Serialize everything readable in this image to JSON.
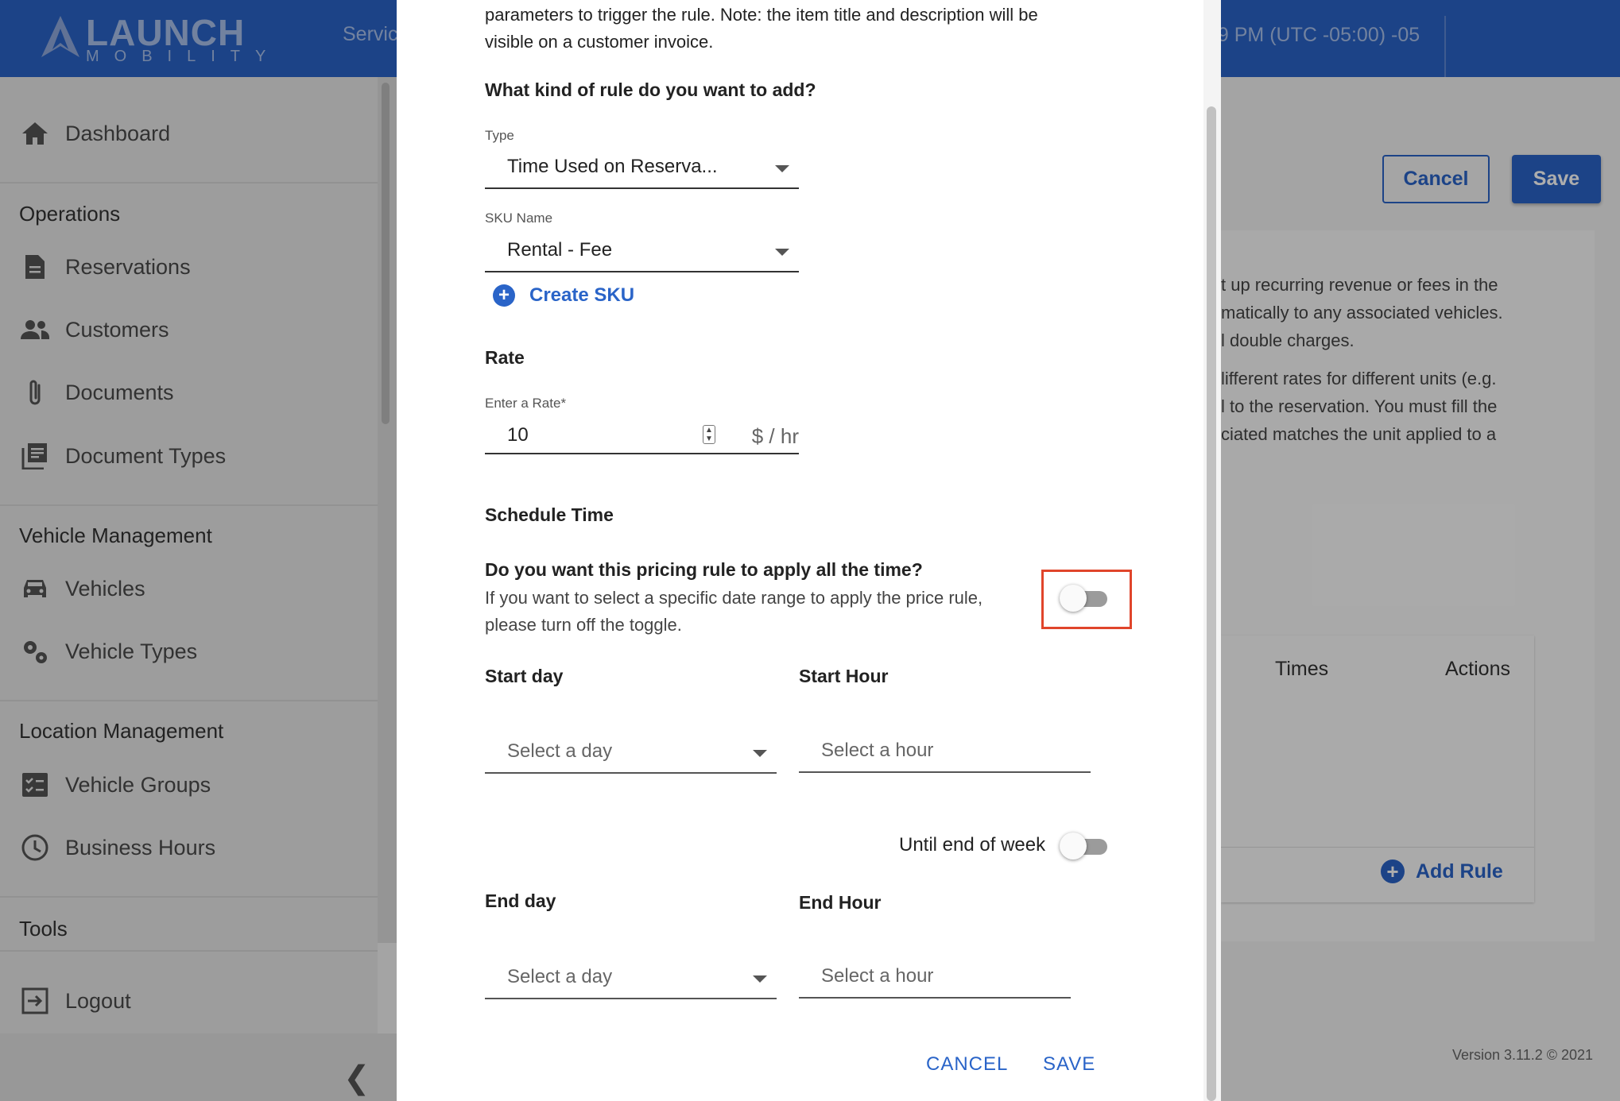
{
  "app": {
    "logo_text": "LAUNCH",
    "logo_sub": "MOBILITY",
    "topbar_services": "Servic",
    "topbar_time": "59 PM (UTC -05:00) -05"
  },
  "sidebar": {
    "dashboard": "Dashboard",
    "sections": {
      "operations": "Operations",
      "vehicle_management": "Vehicle Management",
      "location_management": "Location Management",
      "tools": "Tools"
    },
    "items": {
      "reservations": "Reservations",
      "customers": "Customers",
      "documents": "Documents",
      "document_types": "Document Types",
      "vehicles": "Vehicles",
      "vehicle_types": "Vehicle Types",
      "vehicle_groups": "Vehicle Groups",
      "business_hours": "Business Hours",
      "logout": "Logout"
    }
  },
  "page": {
    "cancel_label": "Cancel",
    "save_label": "Save",
    "desc_lines": [
      "t up recurring revenue or fees in the",
      "matically to any associated vehicles.",
      "l double charges.",
      "lifferent rates for different units (e.g.",
      "l to the reservation. You must fill the",
      "ciated matches the unit applied to a"
    ],
    "table_headers": {
      "times": "Times",
      "actions": "Actions"
    },
    "add_rule_label": "Add Rule",
    "version": "Version 3.11.2 © 2021"
  },
  "modal": {
    "intro_line1": "parameters to trigger the rule. Note: the item title and description will be",
    "intro_line2": "visible on a customer invoice.",
    "kind_title": "What kind of rule do you want to add?",
    "type_label": "Type",
    "type_value": "Time Used on Reserva...",
    "sku_label": "SKU Name",
    "sku_value": "Rental - Fee",
    "create_sku_label": "Create SKU",
    "rate_title": "Rate",
    "rate_label": "Enter a Rate*",
    "rate_value": "10",
    "rate_unit": "$ / hr",
    "schedule_title": "Schedule Time",
    "apply_all_question": "Do you want this pricing rule to apply all the time?",
    "apply_all_desc_line1": "If you want to select a specific date range to apply the price rule,",
    "apply_all_desc_line2": "please turn off the toggle.",
    "apply_all_on": false,
    "start_day_title": "Start day",
    "start_hour_title": "Start Hour",
    "select_day_placeholder": "Select a day",
    "select_hour_placeholder": "Select a hour",
    "until_end_of_week_label": "Until end of week",
    "until_end_of_week_on": false,
    "end_day_title": "End day",
    "end_hour_title": "End Hour",
    "cancel_button": "CANCEL",
    "save_button": "SAVE"
  },
  "colors": {
    "brand_blue": "#2a64c8",
    "highlight_red": "#e0452b"
  }
}
